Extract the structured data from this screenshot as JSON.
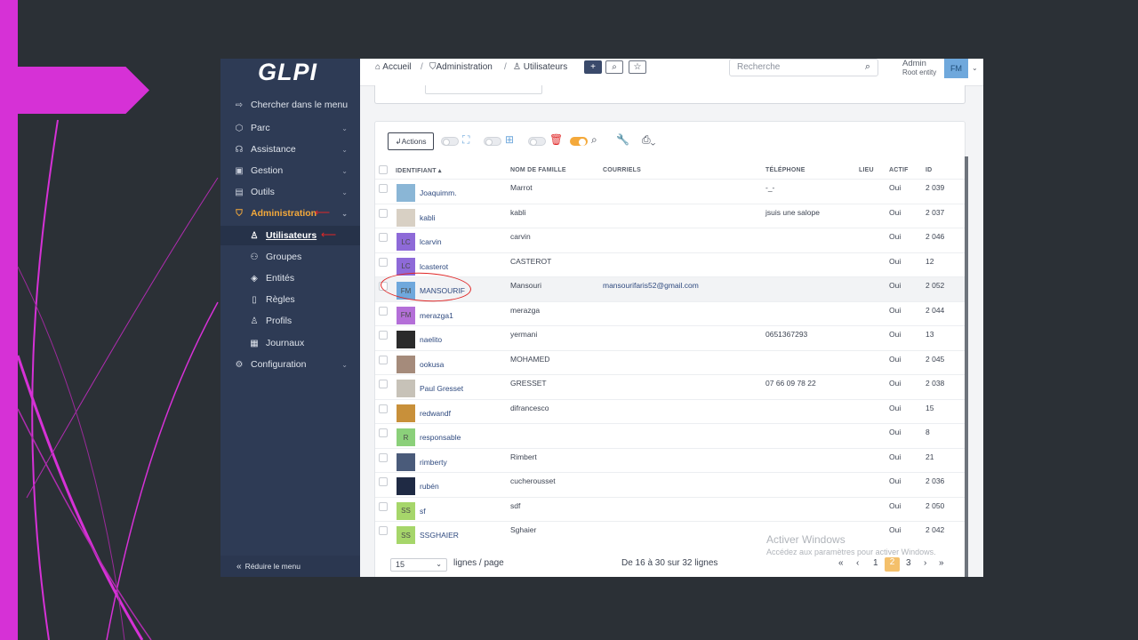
{
  "app": {
    "logo": "GLPI"
  },
  "sidebar": {
    "search_label": "Chercher dans le menu",
    "items": [
      {
        "label": "Parc",
        "icon": "box-icon"
      },
      {
        "label": "Assistance",
        "icon": "headset-icon"
      },
      {
        "label": "Gestion",
        "icon": "wallet-icon"
      },
      {
        "label": "Outils",
        "icon": "briefcase-icon"
      },
      {
        "label": "Administration",
        "icon": "shield-icon"
      },
      {
        "label": "Configuration",
        "icon": "gear-icon"
      }
    ],
    "subitems": [
      {
        "label": "Utilisateurs",
        "icon": "user-icon"
      },
      {
        "label": "Groupes",
        "icon": "users-icon"
      },
      {
        "label": "Entités",
        "icon": "layers-icon"
      },
      {
        "label": "Règles",
        "icon": "book-icon"
      },
      {
        "label": "Profils",
        "icon": "user-check-icon"
      },
      {
        "label": "Journaux",
        "icon": "log-icon"
      }
    ],
    "collapse_label": "Réduire le menu"
  },
  "header": {
    "breadcrumb": [
      "Accueil",
      "Administration",
      "Utilisateurs"
    ],
    "search_placeholder": "Recherche",
    "user_name": "Admin",
    "user_entity": "Root entity",
    "user_initials": "FM"
  },
  "toolbar": {
    "actions_label": "Actions"
  },
  "table": {
    "columns": [
      "IDENTIFIANT",
      "NOM DE FAMILLE",
      "COURRIELS",
      "TÉLÉPHONE",
      "LIEU",
      "ACTIF",
      "ID"
    ],
    "rows": [
      {
        "login": "Joaquimm.",
        "nom": "Marrot",
        "mail": "",
        "tel": "-_-",
        "actif": "Oui",
        "id": "2 039",
        "avatar": "",
        "avatar_color": "#8ab6d6"
      },
      {
        "login": "kabli",
        "nom": "kabli",
        "mail": "",
        "tel": "jsuis une salope",
        "actif": "Oui",
        "id": "2 037",
        "avatar": "",
        "avatar_color": "#d8d0c4"
      },
      {
        "login": "lcarvin",
        "nom": "carvin",
        "mail": "",
        "tel": "",
        "actif": "Oui",
        "id": "2 046",
        "avatar": "LC",
        "avatar_color": "#8e6ad8"
      },
      {
        "login": "lcasterot",
        "nom": "CASTEROT",
        "mail": "",
        "tel": "",
        "actif": "Oui",
        "id": "12",
        "avatar": "LC",
        "avatar_color": "#8e6ad8"
      },
      {
        "login": "MANSOURIF",
        "nom": "Mansouri",
        "mail": "mansourifaris52@gmail.com",
        "tel": "",
        "actif": "Oui",
        "id": "2 052",
        "avatar": "FM",
        "avatar_color": "#6fa8dc"
      },
      {
        "login": "merazga1",
        "nom": "merazga",
        "mail": "",
        "tel": "",
        "actif": "Oui",
        "id": "2 044",
        "avatar": "FM",
        "avatar_color": "#b46fd8"
      },
      {
        "login": "naelito",
        "nom": "yermani",
        "mail": "",
        "tel": "0651367293",
        "actif": "Oui",
        "id": "13",
        "avatar": "",
        "avatar_color": "#2b2b2b"
      },
      {
        "login": "ookusa",
        "nom": "MOHAMED",
        "mail": "",
        "tel": "",
        "actif": "Oui",
        "id": "2 045",
        "avatar": "",
        "avatar_color": "#a58b7b"
      },
      {
        "login": "Paul Gresset",
        "nom": "GRESSET",
        "mail": "",
        "tel": "07 66 09 78 22",
        "actif": "Oui",
        "id": "2 038",
        "avatar": "",
        "avatar_color": "#c7c2b8"
      },
      {
        "login": "redwandf",
        "nom": "difrancesco",
        "mail": "",
        "tel": "",
        "actif": "Oui",
        "id": "15",
        "avatar": "",
        "avatar_color": "#c8903a"
      },
      {
        "login": "responsable",
        "nom": "",
        "mail": "",
        "tel": "",
        "actif": "Oui",
        "id": "8",
        "avatar": "R",
        "avatar_color": "#8bd07a"
      },
      {
        "login": "rimberty",
        "nom": "Rimbert",
        "mail": "",
        "tel": "",
        "actif": "Oui",
        "id": "21",
        "avatar": "",
        "avatar_color": "#4a5b7a"
      },
      {
        "login": "rubén",
        "nom": "cucherousset",
        "mail": "",
        "tel": "",
        "actif": "Oui",
        "id": "2 036",
        "avatar": "",
        "avatar_color": "#1f2a44"
      },
      {
        "login": "sf",
        "nom": "sdf",
        "mail": "",
        "tel": "",
        "actif": "Oui",
        "id": "2 050",
        "avatar": "SS",
        "avatar_color": "#a6d66a"
      },
      {
        "login": "SSGHAIER",
        "nom": "Sghaier",
        "mail": "",
        "tel": "",
        "actif": "Oui",
        "id": "2 042",
        "avatar": "SS",
        "avatar_color": "#a6d66a"
      }
    ]
  },
  "footer": {
    "per_page": "15",
    "per_page_label": "lignes / page",
    "range_text": "De 16 à 30 sur 32 lignes",
    "pages": [
      "1",
      "2",
      "3"
    ],
    "current_page": "2"
  },
  "watermark": {
    "line1": "Activer Windows",
    "line2": "Accédez aux paramètres pour activer Windows."
  },
  "colors": {
    "accent": "#f4a93b",
    "sidebar": "#2e3b55",
    "magenta": "#d631d6",
    "annotation": "#e02727"
  }
}
